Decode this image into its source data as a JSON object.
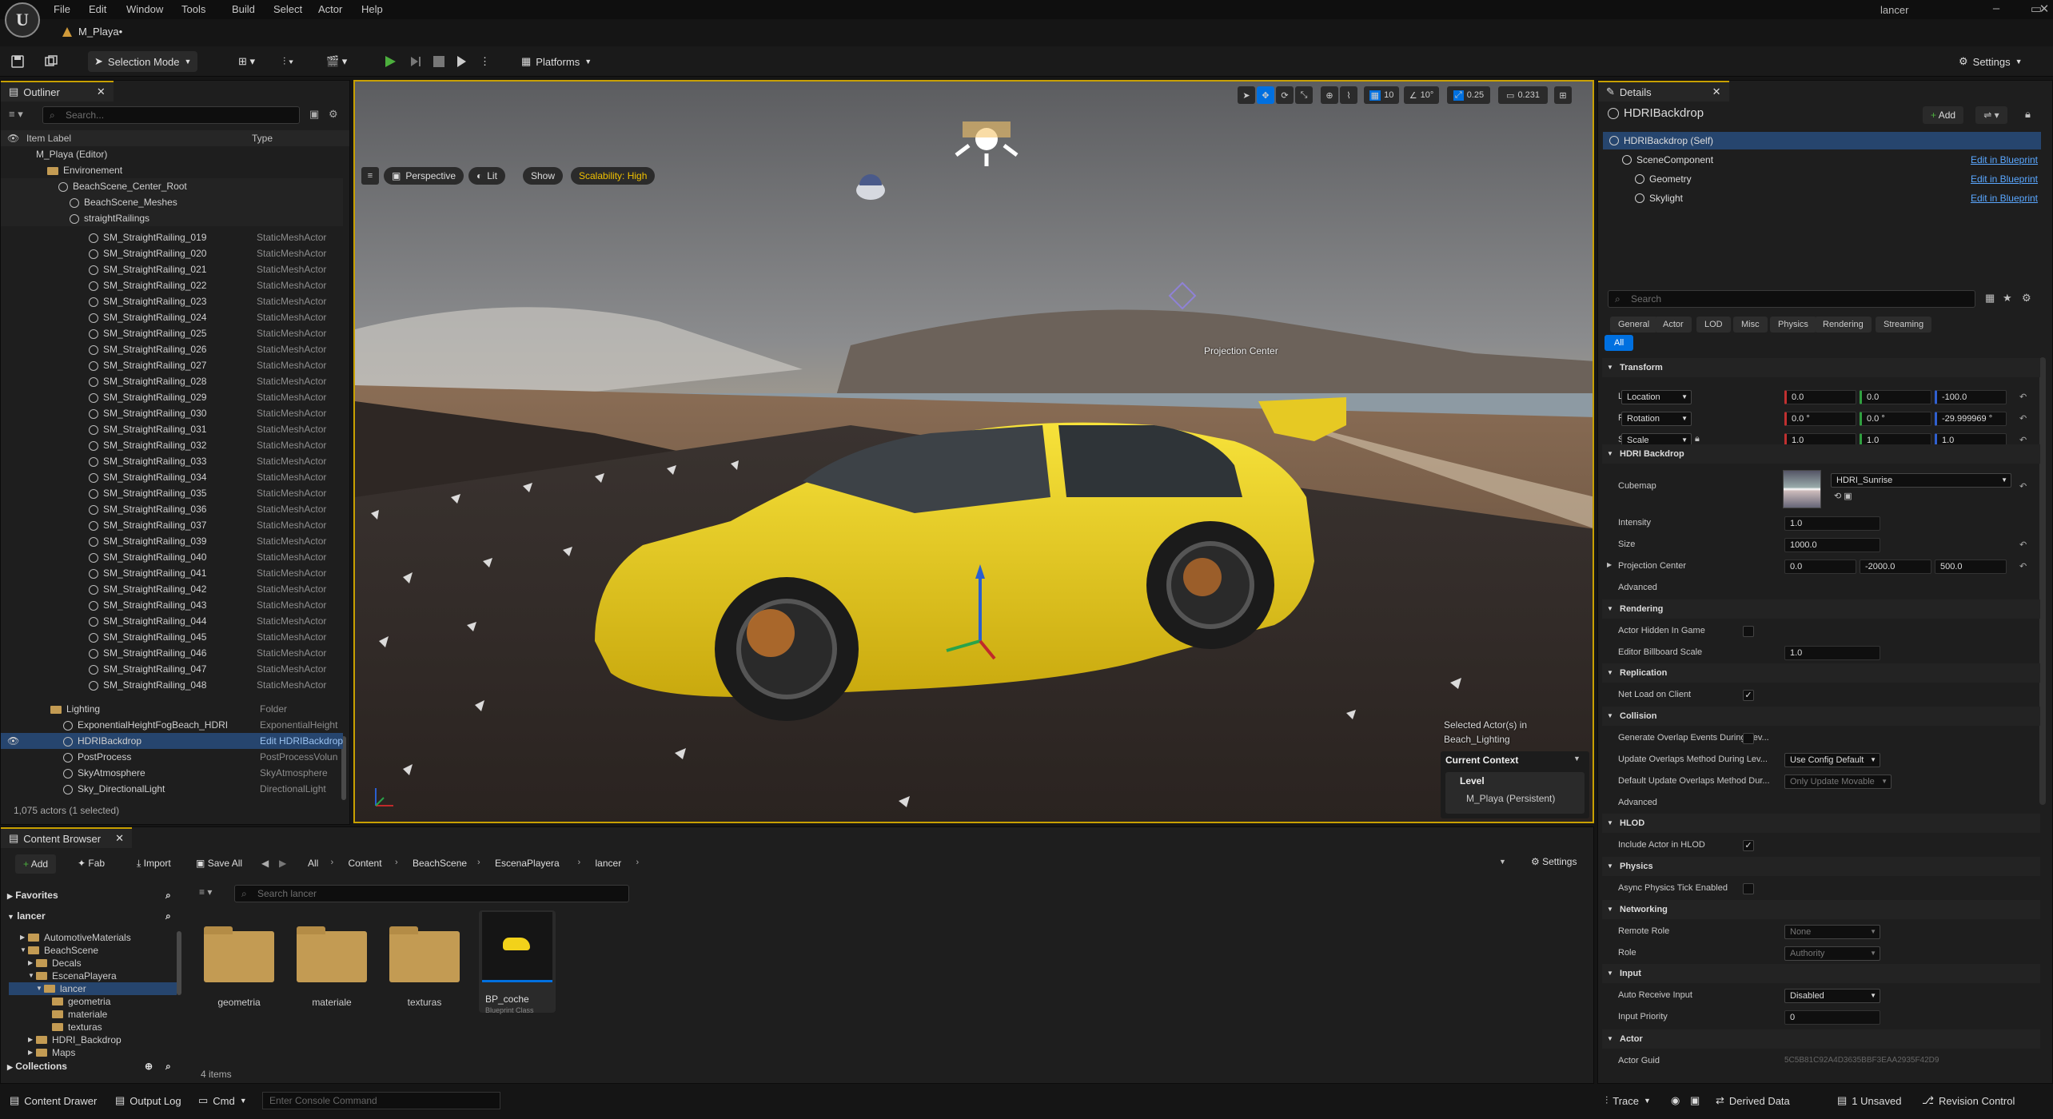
{
  "window": {
    "user": "lancer",
    "level_tab": "M_Playa•"
  },
  "menu": [
    "File",
    "Edit",
    "Window",
    "Tools",
    "Build",
    "Select",
    "Actor",
    "Help"
  ],
  "toolbar": {
    "selection_mode": "Selection Mode",
    "platforms": "Platforms",
    "settings": "Settings"
  },
  "outliner": {
    "tab": "Outliner",
    "search_placeholder": "Search...",
    "col_label": "Item Label",
    "col_type": "Type",
    "tree": [
      {
        "label": "M_Playa (Editor)",
        "indent": 0,
        "kind": "world"
      },
      {
        "label": "Environement",
        "indent": 1,
        "kind": "folder"
      },
      {
        "label": "BeachScene_Center_Root",
        "indent": 2,
        "kind": "actor"
      },
      {
        "label": "BeachScene_Meshes",
        "indent": 3,
        "kind": "actor"
      },
      {
        "label": "straightRailings",
        "indent": 3,
        "kind": "actor"
      }
    ],
    "railings": [
      "SM_StraightRailing_019",
      "SM_StraightRailing_020",
      "SM_StraightRailing_021",
      "SM_StraightRailing_022",
      "SM_StraightRailing_023",
      "SM_StraightRailing_024",
      "SM_StraightRailing_025",
      "SM_StraightRailing_026",
      "SM_StraightRailing_027",
      "SM_StraightRailing_028",
      "SM_StraightRailing_029",
      "SM_StraightRailing_030",
      "SM_StraightRailing_031",
      "SM_StraightRailing_032",
      "SM_StraightRailing_033",
      "SM_StraightRailing_034",
      "SM_StraightRailing_035",
      "SM_StraightRailing_036",
      "SM_StraightRailing_037",
      "SM_StraightRailing_039",
      "SM_StraightRailing_040",
      "SM_StraightRailing_041",
      "SM_StraightRailing_042",
      "SM_StraightRailing_043",
      "SM_StraightRailing_044",
      "SM_StraightRailing_045",
      "SM_StraightRailing_046",
      "SM_StraightRailing_047",
      "SM_StraightRailing_048"
    ],
    "railing_type": "StaticMeshActor",
    "lighting": [
      {
        "label": "Lighting",
        "type": "Folder"
      },
      {
        "label": "ExponentialHeightFogBeach_HDRI",
        "type": "ExponentialHeight"
      },
      {
        "label": "HDRIBackdrop",
        "type": "Edit HDRIBackdrop"
      },
      {
        "label": "PostProcess",
        "type": "PostProcessVolun"
      },
      {
        "label": "SkyAtmosphere",
        "type": "SkyAtmosphere"
      },
      {
        "label": "Sky_DirectionalLight",
        "type": "DirectionalLight"
      }
    ],
    "footer": "1,075 actors (1 selected)"
  },
  "viewport": {
    "perspective": "Perspective",
    "lit": "Lit",
    "show": "Show",
    "scalability": "Scalability: High",
    "grid": "10",
    "angle": "10°",
    "scale": "0.25",
    "camera_speed": "0.231",
    "projection_label": "Projection Center",
    "selected_info": "Selected Actor(s) in",
    "selected_level": "Beach_Lighting",
    "current_context": "Current Context",
    "level_label": "Level",
    "level_value": "M_Playa (Persistent)"
  },
  "details": {
    "tab": "Details",
    "actor": "HDRIBackdrop",
    "add": "Add",
    "components": [
      {
        "label": "HDRIBackdrop (Self)",
        "indent": 0,
        "link": ""
      },
      {
        "label": "SceneComponent",
        "indent": 1,
        "link": "Edit in Blueprint"
      },
      {
        "label": "Geometry",
        "indent": 2,
        "link": "Edit in Blueprint"
      },
      {
        "label": "Skylight",
        "indent": 2,
        "link": "Edit in Blueprint"
      }
    ],
    "search_placeholder": "Search",
    "categories": [
      "General",
      "Actor",
      "LOD",
      "Misc",
      "Physics",
      "Rendering",
      "Streaming"
    ],
    "all": "All",
    "transform": {
      "title": "Transform",
      "location_label": "Location",
      "location": [
        "0.0",
        "0.0",
        "-100.0"
      ],
      "rotation_label": "Rotation",
      "rotation": [
        "0.0 °",
        "0.0 °",
        "-29.999969 °"
      ],
      "scale_label": "Scale",
      "scale": [
        "1.0",
        "1.0",
        "1.0"
      ]
    },
    "hdri": {
      "title": "HDRI Backdrop",
      "cubemap_label": "Cubemap",
      "cubemap": "HDRI_Sunrise",
      "intensity_label": "Intensity",
      "intensity": "1.0",
      "size_label": "Size",
      "size": "1000.0",
      "projection_label": "Projection Center",
      "projection": [
        "0.0",
        "-2000.0",
        "500.0"
      ],
      "advanced": "Advanced"
    },
    "rendering": {
      "title": "Rendering",
      "hidden_label": "Actor Hidden In Game",
      "billboard_label": "Editor Billboard Scale",
      "billboard": "1.0"
    },
    "replication": {
      "title": "Replication",
      "net_label": "Net Load on Client"
    },
    "collision": {
      "title": "Collision",
      "overlap_label": "Generate Overlap Events During Lev...",
      "update_label": "Update Overlaps Method During Lev...",
      "update_value": "Use Config Default",
      "default_label": "Default Update Overlaps Method Dur...",
      "default_value": "Only Update Movable",
      "advanced": "Advanced"
    },
    "hlod": {
      "title": "HLOD",
      "include_label": "Include Actor in HLOD"
    },
    "physics": {
      "title": "Physics",
      "async_label": "Async Physics Tick Enabled"
    },
    "networking": {
      "title": "Networking",
      "remote_label": "Remote Role",
      "remote_value": "None",
      "role_label": "Role",
      "role_value": "Authority"
    },
    "input": {
      "title": "Input",
      "auto_label": "Auto Receive Input",
      "auto_value": "Disabled",
      "priority_label": "Input Priority",
      "priority": "0"
    },
    "actor_section": {
      "title": "Actor",
      "guid_label": "Actor Guid",
      "guid": "5C5B81C92A4D3635BBF3EAA2935F42D9"
    }
  },
  "content_browser": {
    "tab": "Content Browser",
    "add": "Add",
    "fab": "Fab",
    "import": "Import",
    "save_all": "Save All",
    "path": [
      "All",
      "Content",
      "BeachScene",
      "EscenaPlayera",
      "lancer"
    ],
    "settings": "Settings",
    "favorites": "Favorites",
    "root": "lancer",
    "tree": [
      {
        "label": "AutomotiveMaterials",
        "indent": 1
      },
      {
        "label": "BeachScene",
        "indent": 1
      },
      {
        "label": "Decals",
        "indent": 2
      },
      {
        "label": "EscenaPlayera",
        "indent": 2
      },
      {
        "label": "lancer",
        "indent": 3
      },
      {
        "label": "geometria",
        "indent": 4
      },
      {
        "label": "materiale",
        "indent": 4
      },
      {
        "label": "texturas",
        "indent": 4
      },
      {
        "label": "HDRI_Backdrop",
        "indent": 2
      },
      {
        "label": "Maps",
        "indent": 2
      }
    ],
    "collections": "Collections",
    "search_placeholder": "Search lancer",
    "assets": [
      {
        "label": "geometria",
        "kind": "folder"
      },
      {
        "label": "materiale",
        "kind": "folder"
      },
      {
        "label": "texturas",
        "kind": "folder"
      },
      {
        "label": "BP_coche",
        "kind": "blueprint",
        "sub": "Blueprint Class"
      }
    ],
    "count": "4 items"
  },
  "statusbar": {
    "content_drawer": "Content Drawer",
    "output_log": "Output Log",
    "cmd": "Cmd",
    "console_placeholder": "Enter Console Command",
    "trace": "Trace",
    "derived_data": "Derived Data",
    "unsaved": "1 Unsaved",
    "revision": "Revision Control"
  },
  "colors": {
    "accent": "#0070e0",
    "selection": "#26456e",
    "viewport_border": "#c8a000",
    "play": "#4caf3d",
    "car": "#f2d21a"
  }
}
